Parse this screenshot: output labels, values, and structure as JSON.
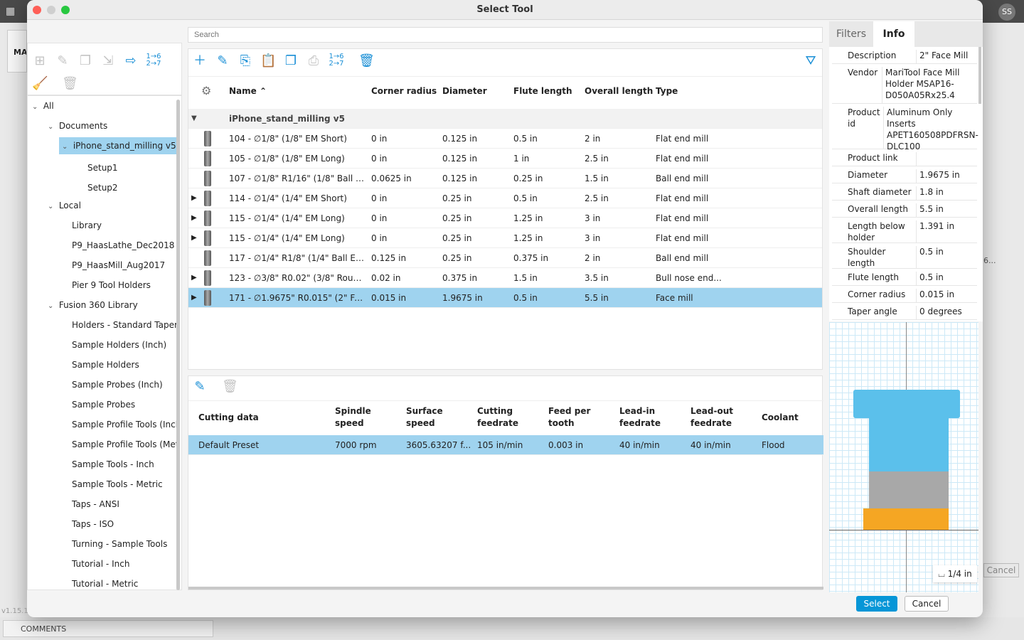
{
  "window": {
    "title": "Select Tool",
    "version": "v1.15.1"
  },
  "background": {
    "left_tab": "MAI",
    "avatar": "SS",
    "comments": "COMMENTS",
    "cancel": "Cancel",
    "ellipsis": "6..."
  },
  "search": {
    "placeholder": "Search",
    "value": ""
  },
  "tree": [
    {
      "label": "All",
      "level": 0,
      "chevron": "down"
    },
    {
      "label": "Documents",
      "level": 1,
      "chevron": "down"
    },
    {
      "label": "iPhone_stand_milling v5",
      "level": 2,
      "chevron": "down",
      "selected": true
    },
    {
      "label": "Setup1",
      "level": 3
    },
    {
      "label": "Setup2",
      "level": 3
    },
    {
      "label": "Local",
      "level": 1,
      "chevron": "down"
    },
    {
      "label": "Library",
      "level": 2
    },
    {
      "label": "P9_HaasLathe_Dec2018",
      "level": 2
    },
    {
      "label": "P9_HaasMill_Aug2017",
      "level": 2
    },
    {
      "label": "Pier 9 Tool Holders",
      "level": 2
    },
    {
      "label": "Fusion 360 Library",
      "level": 1,
      "chevron": "down"
    },
    {
      "label": "Holders - Standard Taper Blanks",
      "level": 2
    },
    {
      "label": "Sample Holders (Inch)",
      "level": 2
    },
    {
      "label": "Sample Holders",
      "level": 2
    },
    {
      "label": "Sample Probes (Inch)",
      "level": 2
    },
    {
      "label": "Sample Probes",
      "level": 2
    },
    {
      "label": "Sample Profile Tools (Inch)",
      "level": 2
    },
    {
      "label": "Sample Profile Tools (Metric)",
      "level": 2
    },
    {
      "label": "Sample Tools - Inch",
      "level": 2
    },
    {
      "label": "Sample Tools - Metric",
      "level": 2
    },
    {
      "label": "Taps - ANSI",
      "level": 2
    },
    {
      "label": "Taps - ISO",
      "level": 2
    },
    {
      "label": "Turning - Sample Tools",
      "level": 2
    },
    {
      "label": "Tutorial - Inch",
      "level": 2
    },
    {
      "label": "Tutorial - Metric",
      "level": 2
    }
  ],
  "tools": {
    "columns": [
      "Name",
      "Corner radius",
      "Diameter",
      "Flute length",
      "Overall length",
      "Type"
    ],
    "sort": "Name ascending",
    "group": "iPhone_stand_milling v5",
    "rows": [
      {
        "name": "104 - ∅1/8\" (1/8\" EM Short)",
        "corner": "0 in",
        "dia": "0.125 in",
        "flute": "0.5 in",
        "overall": "2 in",
        "type": "Flat end mill",
        "expand": false
      },
      {
        "name": "105 - ∅1/8\" (1/8\" EM Long)",
        "corner": "0 in",
        "dia": "0.125 in",
        "flute": "1 in",
        "overall": "2.5 in",
        "type": "Flat end mill",
        "expand": false
      },
      {
        "name": "107 - ∅1/8\" R1/16\" (1/8\" Ball E...",
        "corner": "0.0625 in",
        "dia": "0.125 in",
        "flute": "0.25 in",
        "overall": "1.5 in",
        "type": "Ball end mill",
        "expand": false
      },
      {
        "name": "114 - ∅1/4\" (1/4\" EM Short)",
        "corner": "0 in",
        "dia": "0.25 in",
        "flute": "0.5 in",
        "overall": "2.5 in",
        "type": "Flat end mill",
        "expand": true
      },
      {
        "name": "115 - ∅1/4\" (1/4\" EM Long)",
        "corner": "0 in",
        "dia": "0.25 in",
        "flute": "1.25 in",
        "overall": "3 in",
        "type": "Flat end mill",
        "expand": true
      },
      {
        "name": "115 - ∅1/4\" (1/4\" EM Long)",
        "corner": "0 in",
        "dia": "0.25 in",
        "flute": "1.25 in",
        "overall": "3 in",
        "type": "Flat end mill",
        "expand": true
      },
      {
        "name": "117 - ∅1/4\" R1/8\" (1/4\" Ball EM ...",
        "corner": "0.125 in",
        "dia": "0.25 in",
        "flute": "0.375 in",
        "overall": "2 in",
        "type": "Ball end mill",
        "expand": false
      },
      {
        "name": "123 - ∅3/8\" R0.02\" (3/8\" Rough...",
        "corner": "0.02 in",
        "dia": "0.375 in",
        "flute": "1.5 in",
        "overall": "3.5 in",
        "type": "Bull nose end...",
        "expand": true
      },
      {
        "name": "171 - ∅1.9675\" R0.015\" (2\" Face...",
        "corner": "0.015 in",
        "dia": "1.9675 in",
        "flute": "0.5 in",
        "overall": "5.5 in",
        "type": "Face mill",
        "expand": true,
        "selected": true
      }
    ]
  },
  "cutting": {
    "columns": [
      "Cutting data",
      "Spindle speed",
      "Surface speed",
      "Cutting feedrate",
      "Feed per tooth",
      "Lead-in feedrate",
      "Lead-out feedrate",
      "Coolant"
    ],
    "rows": [
      [
        "Default Preset",
        "7000 rpm",
        "3605.63207 f...",
        "105 in/min",
        "0.003 in",
        "40 in/min",
        "40 in/min",
        "Flood"
      ]
    ]
  },
  "tabs": [
    {
      "label": "Filters",
      "active": false
    },
    {
      "label": "Info",
      "active": true
    }
  ],
  "info": [
    {
      "k": "Description",
      "v": "2\" Face Mill"
    },
    {
      "k": "Vendor",
      "v": "MariTool Face Mill Holder MSAP16-D050A05Rx25.4"
    },
    {
      "k": "Product id",
      "v": "Aluminum Only Inserts APET160508PDFRSN-DLC100"
    },
    {
      "k": "Product link",
      "v": ""
    },
    {
      "k": "Diameter",
      "v": "1.9675 in"
    },
    {
      "k": "Shaft diameter",
      "v": "1.8 in"
    },
    {
      "k": "Overall length",
      "v": "5.5 in"
    },
    {
      "k": "Length below holder",
      "v": "1.391 in"
    },
    {
      "k": "Shoulder length",
      "v": "0.5 in"
    },
    {
      "k": "Flute length",
      "v": "0.5 in"
    },
    {
      "k": "Corner radius",
      "v": "0.015 in"
    },
    {
      "k": "Taper angle",
      "v": "0 degrees"
    }
  ],
  "preview": {
    "scale": "1/4 in",
    "colors": {
      "holder": "#5bc0eb",
      "shaft": "#a8a8a8",
      "cutter": "#f5a623"
    }
  },
  "buttons": {
    "select": "Select",
    "cancel": "Cancel"
  },
  "colors": {
    "accent": "#1a8fd6",
    "selection": "#9fd3ef"
  }
}
